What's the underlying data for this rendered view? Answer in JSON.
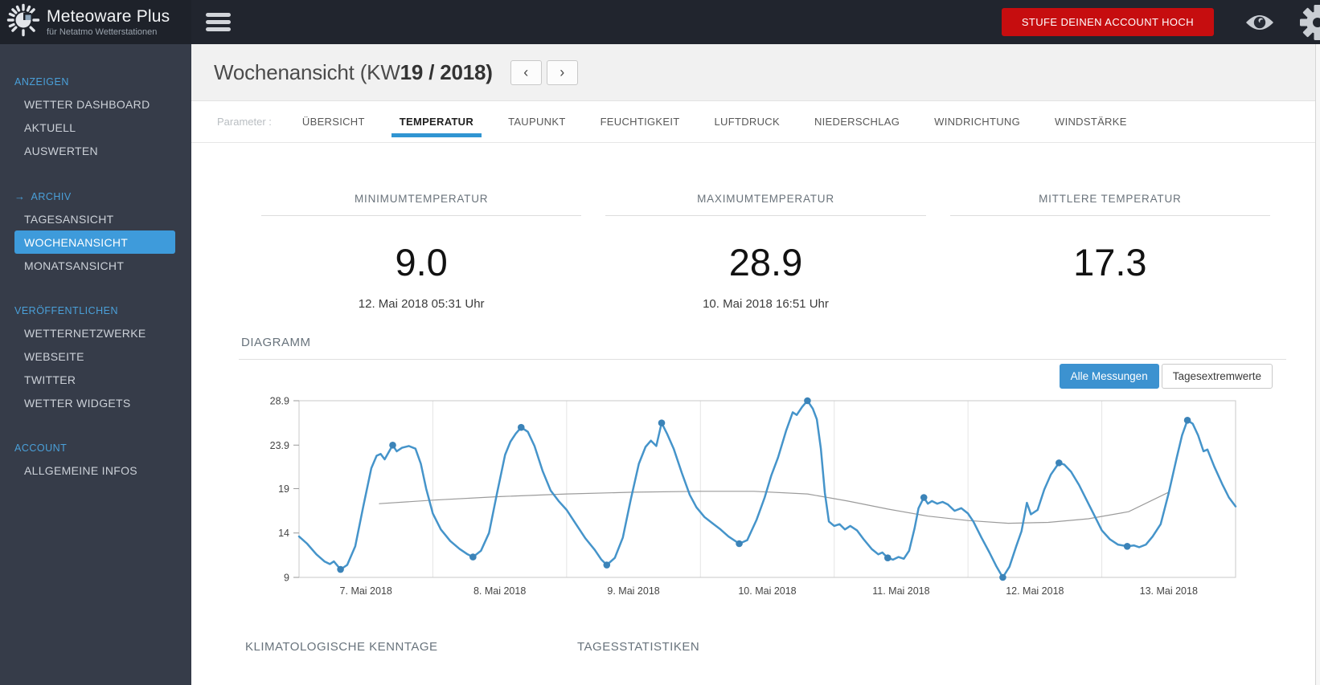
{
  "topbar": {
    "brand_title": "Meteoware Plus",
    "brand_subtitle": "für Netatmo Wetterstationen",
    "upgrade_button": "STUFE DEINEN ACCOUNT HOCH"
  },
  "icons": {
    "logo": "sun-logo-icon",
    "menu": "hamburger-menu-icon",
    "visibility": "eye-icon",
    "settings": "gear-icon",
    "prev": "‹",
    "next": "›",
    "active_section_arrow": "→"
  },
  "sidebar": {
    "groups": [
      {
        "heading": "ANZEIGEN",
        "items": [
          {
            "label": "WETTER DASHBOARD"
          },
          {
            "label": "AKTUELL"
          },
          {
            "label": "AUSWERTEN"
          }
        ]
      },
      {
        "heading": "ARCHIV",
        "arrow": true,
        "items": [
          {
            "label": "TAGESANSICHT"
          },
          {
            "label": "WOCHENANSICHT",
            "active": true
          },
          {
            "label": "MONATSANSICHT"
          }
        ]
      },
      {
        "heading": "VERÖFFENTLICHEN",
        "items": [
          {
            "label": "WETTERNETZWERKE"
          },
          {
            "label": "WEBSEITE"
          },
          {
            "label": "TWITTER"
          },
          {
            "label": "WETTER WIDGETS"
          }
        ]
      },
      {
        "heading": "ACCOUNT",
        "items": [
          {
            "label": "ALLGEMEINE INFOS"
          }
        ]
      }
    ]
  },
  "page_header": {
    "title_regular": "Wochenansicht (KW",
    "title_bold": "19 / 2018)"
  },
  "tabs": {
    "label": "Parameter :",
    "active": "TEMPERATUR",
    "items": [
      "ÜBERSICHT",
      "TEMPERATUR",
      "TAUPUNKT",
      "FEUCHTIGKEIT",
      "LUFTDRUCK",
      "NIEDERSCHLAG",
      "WINDRICHTUNG",
      "WINDSTÄRKE"
    ]
  },
  "stats": [
    {
      "label": "MINIMUMTEMPERATUR",
      "value": "9.0",
      "time": "12. Mai 2018 05:31 Uhr"
    },
    {
      "label": "MAXIMUMTEMPERATUR",
      "value": "28.9",
      "time": "10. Mai 2018 16:51 Uhr"
    },
    {
      "label": "MITTLERE TEMPERATUR",
      "value": "17.3",
      "time": ""
    }
  ],
  "diagram": {
    "heading": "DIAGRAMM",
    "controls": [
      {
        "label": "Alle Messungen",
        "active": true
      },
      {
        "label": "Tagesextremwerte",
        "active": false
      }
    ]
  },
  "bottom_sections": [
    {
      "heading": "KLIMATOLOGISCHE KENNTAGE"
    },
    {
      "heading": "TAGESSTATISTIKEN"
    }
  ],
  "colors": {
    "accent_blue": "#3e9bdb",
    "tab_underline": "#3095d2",
    "alert_red": "#c60d0f",
    "chart_line": "#4594ca",
    "chart_marker": "#3b83b8",
    "trend_line": "#9b9b9b"
  },
  "chart_data": {
    "type": "line",
    "x_labels": [
      "7. Mai 2018",
      "8. Mai 2018",
      "9. Mai 2018",
      "10. Mai 2018",
      "11. Mai 2018",
      "12. Mai 2018",
      "13. Mai 2018"
    ],
    "x_domain_days": [
      0,
      7
    ],
    "ylim": [
      9,
      28.9
    ],
    "y_ticks": [
      {
        "value": 9,
        "label": "9"
      },
      {
        "value": 14,
        "label": "14"
      },
      {
        "value": 19,
        "label": "19"
      },
      {
        "value": 23.9,
        "label": "23.9"
      },
      {
        "value": 28.9,
        "label": "28.9"
      }
    ],
    "grid": "vertical lines at day boundaries",
    "legend": "none",
    "series": [
      {
        "name": "temperature",
        "color": "#4594ca",
        "width": 2.5,
        "points": [
          [
            0,
            13.6
          ],
          [
            0.06,
            12.8
          ],
          [
            0.13,
            11.6
          ],
          [
            0.19,
            10.8
          ],
          [
            0.23,
            10.5
          ],
          [
            0.26,
            10.8
          ],
          [
            0.31,
            9.9
          ],
          [
            0.36,
            10.4
          ],
          [
            0.42,
            12.5
          ],
          [
            0.48,
            17
          ],
          [
            0.54,
            21.3
          ],
          [
            0.58,
            22.7
          ],
          [
            0.61,
            22.9
          ],
          [
            0.64,
            22.3
          ],
          [
            0.7,
            23.9
          ],
          [
            0.73,
            23.2
          ],
          [
            0.77,
            23.6
          ],
          [
            0.82,
            23.8
          ],
          [
            0.87,
            23.5
          ],
          [
            0.91,
            21.8
          ],
          [
            0.95,
            19
          ],
          [
            1,
            16.2
          ],
          [
            1.06,
            14.4
          ],
          [
            1.13,
            13.1
          ],
          [
            1.2,
            12.2
          ],
          [
            1.26,
            11.6
          ],
          [
            1.3,
            11.3
          ],
          [
            1.36,
            12
          ],
          [
            1.42,
            14
          ],
          [
            1.48,
            18.5
          ],
          [
            1.54,
            22.8
          ],
          [
            1.58,
            24.3
          ],
          [
            1.62,
            25.2
          ],
          [
            1.66,
            25.9
          ],
          [
            1.71,
            25.4
          ],
          [
            1.76,
            23.8
          ],
          [
            1.82,
            21
          ],
          [
            1.88,
            18.8
          ],
          [
            1.94,
            17.6
          ],
          [
            2,
            16.6
          ],
          [
            2.07,
            15
          ],
          [
            2.14,
            13.4
          ],
          [
            2.21,
            12.1
          ],
          [
            2.26,
            11
          ],
          [
            2.3,
            10.4
          ],
          [
            2.36,
            11.2
          ],
          [
            2.42,
            13.5
          ],
          [
            2.48,
            17.8
          ],
          [
            2.54,
            21.8
          ],
          [
            2.59,
            23.7
          ],
          [
            2.63,
            24.4
          ],
          [
            2.67,
            23.8
          ],
          [
            2.71,
            26.4
          ],
          [
            2.75,
            25.2
          ],
          [
            2.8,
            23.5
          ],
          [
            2.86,
            20.8
          ],
          [
            2.92,
            18.3
          ],
          [
            2.97,
            16.9
          ],
          [
            3.03,
            15.8
          ],
          [
            3.09,
            15.1
          ],
          [
            3.15,
            14.4
          ],
          [
            3.21,
            13.6
          ],
          [
            3.29,
            12.8
          ],
          [
            3.35,
            13.2
          ],
          [
            3.42,
            15.5
          ],
          [
            3.48,
            18
          ],
          [
            3.53,
            20.5
          ],
          [
            3.58,
            22.5
          ],
          [
            3.64,
            25.5
          ],
          [
            3.69,
            27.6
          ],
          [
            3.72,
            27.3
          ],
          [
            3.76,
            28.2
          ],
          [
            3.8,
            28.9
          ],
          [
            3.84,
            28
          ],
          [
            3.87,
            26.8
          ],
          [
            3.9,
            23.5
          ],
          [
            3.93,
            18.5
          ],
          [
            3.96,
            15.3
          ],
          [
            4,
            14.8
          ],
          [
            4.04,
            15
          ],
          [
            4.08,
            14.4
          ],
          [
            4.12,
            14.8
          ],
          [
            4.17,
            14.3
          ],
          [
            4.22,
            13.3
          ],
          [
            4.28,
            12.2
          ],
          [
            4.33,
            11.6
          ],
          [
            4.36,
            11.8
          ],
          [
            4.4,
            11.2
          ],
          [
            4.44,
            11
          ],
          [
            4.48,
            11.3
          ],
          [
            4.52,
            11.1
          ],
          [
            4.56,
            12
          ],
          [
            4.6,
            14.5
          ],
          [
            4.63,
            16.8
          ],
          [
            4.67,
            18
          ],
          [
            4.7,
            17.3
          ],
          [
            4.73,
            17.6
          ],
          [
            4.77,
            17.3
          ],
          [
            4.81,
            17.5
          ],
          [
            4.85,
            17.2
          ],
          [
            4.9,
            16.5
          ],
          [
            4.95,
            16.8
          ],
          [
            5,
            16.2
          ],
          [
            5.04,
            15.3
          ],
          [
            5.1,
            13.5
          ],
          [
            5.16,
            11.8
          ],
          [
            5.21,
            10.3
          ],
          [
            5.26,
            9
          ],
          [
            5.31,
            10.2
          ],
          [
            5.36,
            12.5
          ],
          [
            5.4,
            14.2
          ],
          [
            5.44,
            17.4
          ],
          [
            5.47,
            16.1
          ],
          [
            5.52,
            16.6
          ],
          [
            5.57,
            18.9
          ],
          [
            5.62,
            20.6
          ],
          [
            5.68,
            21.9
          ],
          [
            5.72,
            21.7
          ],
          [
            5.77,
            20.9
          ],
          [
            5.83,
            19.4
          ],
          [
            5.89,
            17.6
          ],
          [
            5.95,
            15.8
          ],
          [
            6,
            14.3
          ],
          [
            6.06,
            13.3
          ],
          [
            6.12,
            12.7
          ],
          [
            6.19,
            12.5
          ],
          [
            6.24,
            12.6
          ],
          [
            6.28,
            12.4
          ],
          [
            6.33,
            12.7
          ],
          [
            6.38,
            13.6
          ],
          [
            6.44,
            15
          ],
          [
            6.5,
            18.5
          ],
          [
            6.56,
            22.5
          ],
          [
            6.6,
            25
          ],
          [
            6.64,
            26.7
          ],
          [
            6.68,
            26.3
          ],
          [
            6.72,
            25
          ],
          [
            6.76,
            23.2
          ],
          [
            6.79,
            23.4
          ],
          [
            6.84,
            21.5
          ],
          [
            6.9,
            19.5
          ],
          [
            6.95,
            18
          ],
          [
            7,
            17
          ]
        ]
      },
      {
        "name": "trend",
        "color": "#9b9b9b",
        "width": 1.2,
        "points": [
          [
            0.6,
            17.3
          ],
          [
            1,
            17.7
          ],
          [
            1.5,
            18.1
          ],
          [
            2,
            18.4
          ],
          [
            2.5,
            18.6
          ],
          [
            3,
            18.7
          ],
          [
            3.4,
            18.7
          ],
          [
            3.8,
            18.4
          ],
          [
            4.1,
            17.6
          ],
          [
            4.4,
            16.7
          ],
          [
            4.7,
            15.9
          ],
          [
            5,
            15.4
          ],
          [
            5.3,
            15.1
          ],
          [
            5.6,
            15.2
          ],
          [
            5.9,
            15.6
          ],
          [
            6.2,
            16.4
          ],
          [
            6.5,
            18.6
          ]
        ]
      }
    ],
    "extreme_markers": {
      "name": "daily extremes",
      "color": "#3b83b8",
      "points": [
        [
          0.31,
          9.9
        ],
        [
          0.7,
          23.9
        ],
        [
          1.3,
          11.3
        ],
        [
          1.66,
          25.9
        ],
        [
          2.3,
          10.4
        ],
        [
          2.71,
          26.4
        ],
        [
          3.29,
          12.8
        ],
        [
          3.8,
          28.9
        ],
        [
          4.4,
          11.2
        ],
        [
          4.67,
          18
        ],
        [
          5.26,
          9
        ],
        [
          5.68,
          21.9
        ],
        [
          6.19,
          12.5
        ],
        [
          6.64,
          26.7
        ]
      ]
    }
  }
}
